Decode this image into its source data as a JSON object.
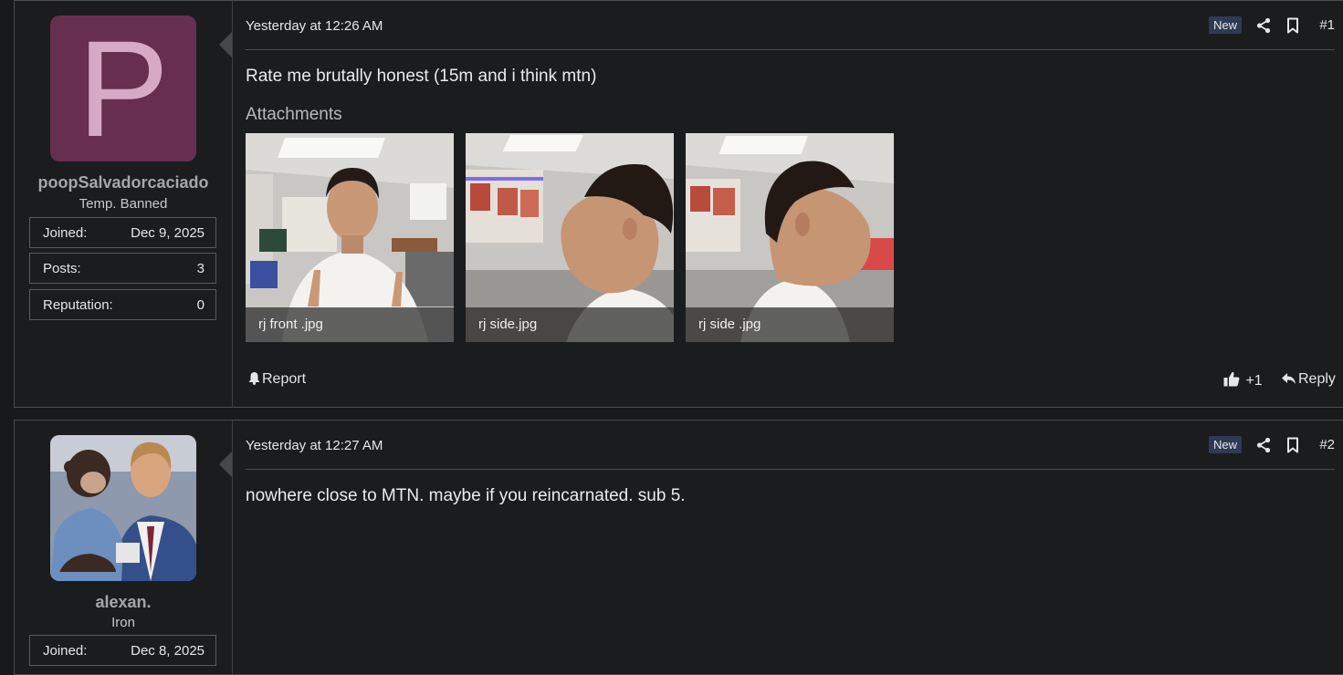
{
  "posts": [
    {
      "avatar_letter": "P",
      "username": "poopSalvadorcaciado",
      "user_title": "Temp. Banned",
      "stats": [
        {
          "label": "Joined:",
          "value": "Dec 9, 2025"
        },
        {
          "label": "Posts:",
          "value": "3"
        },
        {
          "label": "Reputation:",
          "value": "0"
        }
      ],
      "date": "Yesterday at 12:26 AM",
      "badge": "New",
      "number": "#1",
      "message": "Rate me brutally honest (15m and i think mtn)",
      "attachments_title": "Attachments",
      "attachments": [
        {
          "name": "rj front .jpg"
        },
        {
          "name": "rj side.jpg"
        },
        {
          "name": "rj side .jpg"
        }
      ],
      "report_label": "Report",
      "reaction_label": "+1",
      "reply_label": "Reply"
    },
    {
      "username": "alexan.",
      "user_title": "Iron",
      "stats": [
        {
          "label": "Joined:",
          "value": "Dec 8, 2025"
        }
      ],
      "date": "Yesterday at 12:27 AM",
      "badge": "New",
      "number": "#2",
      "message": "nowhere close to MTN. maybe if you reincarnated. sub 5."
    }
  ],
  "colors": {
    "background": "#18191b",
    "avatar_bg": "#662f50",
    "avatar_letter": "#d8a9c4",
    "badge_bg": "#2f3a55"
  }
}
